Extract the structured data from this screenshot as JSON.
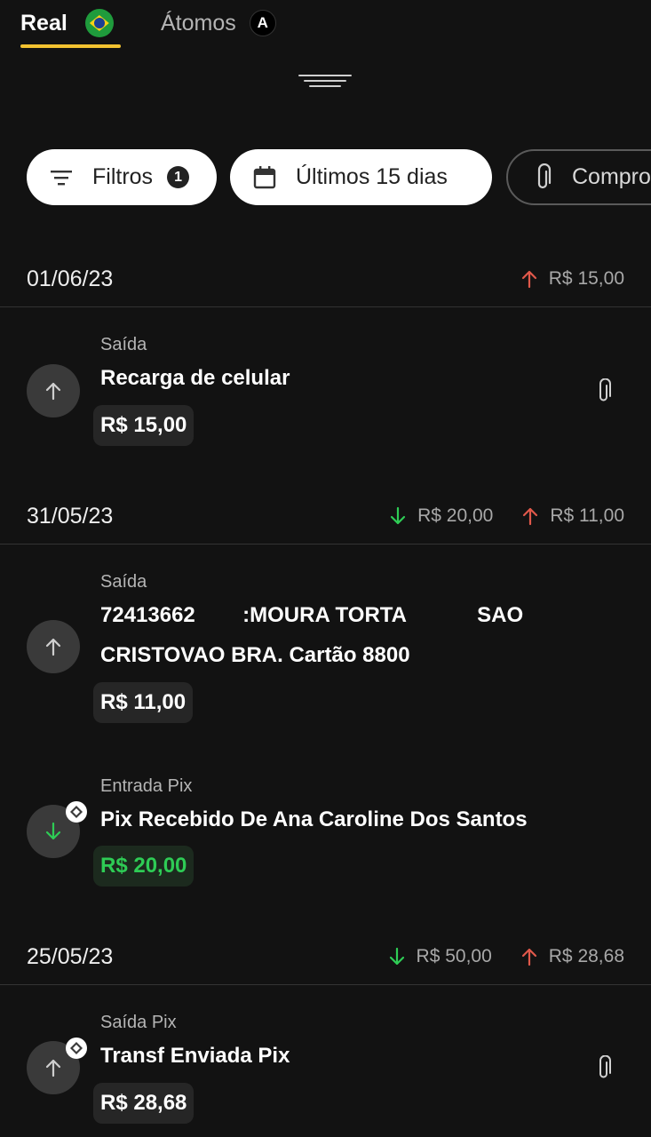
{
  "tabs": {
    "real_label": "Real",
    "atomos_label": "Átomos",
    "atom_badge_letter": "A"
  },
  "filters": {
    "filtros_label": "Filtros",
    "filtros_count": "1",
    "period_label": "Últimos 15 dias",
    "comprovante_label": "Compro"
  },
  "groups": [
    {
      "date": "01/06/23",
      "totals": {
        "entrada": "",
        "saida": "R$ 15,00"
      },
      "transactions": [
        {
          "type": "Saída",
          "description": "Recarga de celular",
          "amount": "R$ 15,00",
          "direction": "out",
          "has_attachment": true,
          "pix": false
        }
      ]
    },
    {
      "date": "31/05/23",
      "totals": {
        "entrada": "R$ 20,00",
        "saida": "R$ 11,00"
      },
      "transactions": [
        {
          "type": "Saída",
          "description_line1": "72413662        :MOURA TORTA            SAO",
          "description_line2": "CRISTOVAO BRA. Cartão 8800",
          "amount": "R$ 11,00",
          "direction": "out",
          "has_attachment": false,
          "pix": false
        },
        {
          "type": "Entrada Pix",
          "description": "Pix Recebido De Ana Caroline Dos Santos",
          "amount": "R$ 20,00",
          "direction": "in",
          "has_attachment": false,
          "pix": true
        }
      ]
    },
    {
      "date": "25/05/23",
      "totals": {
        "entrada": "R$ 50,00",
        "saida": "R$ 28,68"
      },
      "transactions": [
        {
          "type": "Saída Pix",
          "description": "Transf Enviada Pix",
          "amount": "R$ 28,68",
          "direction": "out",
          "has_attachment": true,
          "pix": true
        }
      ]
    }
  ],
  "colors": {
    "accent": "#f2c230",
    "in_green": "#2ecc55",
    "out_red": "#e0584a",
    "background": "#121212"
  },
  "icons": {
    "filter": "filter-icon",
    "calendar": "calendar-icon",
    "paperclip": "paperclip-icon",
    "arrow_up": "arrow-up-icon",
    "arrow_down": "arrow-down-icon",
    "pix": "pix-icon"
  }
}
